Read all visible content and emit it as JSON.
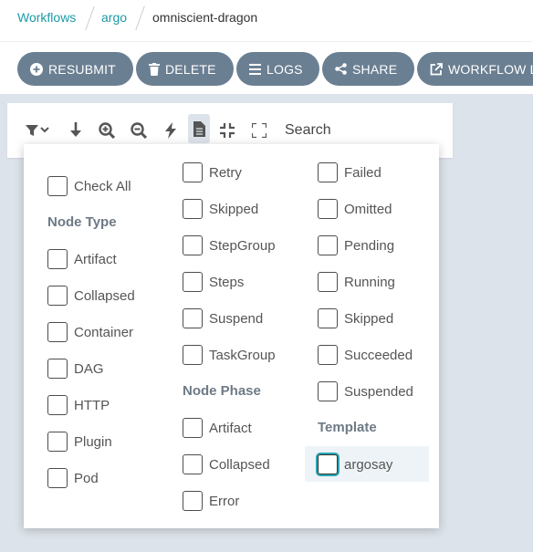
{
  "breadcrumb": {
    "items": [
      "Workflows",
      "argo",
      "omniscient-dragon"
    ]
  },
  "toolbar": {
    "resubmit": "RESUBMIT",
    "delete": "DELETE",
    "logs": "LOGS",
    "share": "SHARE",
    "workflow_link": "WORKFLOW L"
  },
  "graph_toolbar": {
    "search_label": "Search"
  },
  "filters": {
    "check_all": "Check All",
    "node_type_heading": "Node Type",
    "node_types_col1": [
      "Artifact",
      "Collapsed",
      "Container",
      "DAG",
      "HTTP",
      "Plugin",
      "Pod"
    ],
    "node_types_col2": [
      "Retry",
      "Skipped",
      "StepGroup",
      "Steps",
      "Suspend",
      "TaskGroup"
    ],
    "node_phase_heading": "Node Phase",
    "node_phases_col2": [
      "Artifact",
      "Collapsed",
      "Error"
    ],
    "node_phases_col3": [
      "Failed",
      "Omitted",
      "Pending",
      "Running",
      "Skipped",
      "Succeeded",
      "Suspended"
    ],
    "template_heading": "Template",
    "templates": [
      "argosay"
    ]
  },
  "colors": {
    "accent": "#1a9aa6",
    "button": "#6b7f92",
    "background": "#dde3ea"
  }
}
